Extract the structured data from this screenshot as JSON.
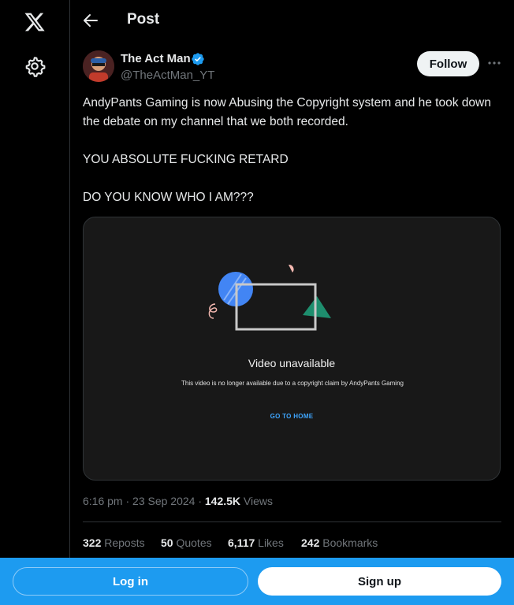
{
  "nav": {
    "logo_icon": "x-logo-icon",
    "settings_icon": "gear-icon"
  },
  "header": {
    "title": "Post",
    "back_icon": "arrow-left-icon"
  },
  "post": {
    "author_name": "The Act Man",
    "author_handle": "@TheActMan_YT",
    "verified": true,
    "follow_label": "Follow",
    "more_icon": "more-horizontal-icon",
    "text_lines": [
      "AndyPants Gaming is now Abusing the Copyright system and he took down the debate on my channel that we both recorded.",
      "YOU ABSOLUTE FUCKING RETARD",
      "DO YOU KNOW WHO I AM???"
    ],
    "media": {
      "title": "Video unavailable",
      "description": "This video is no longer available due to a copyright claim by AndyPants Gaming",
      "link_label": "GO TO HOME"
    },
    "timestamp": "6:16 pm · 23 Sep 2024 · ",
    "views_count": "142.5K",
    "views_label": "Views",
    "stats": {
      "reposts_count": "322",
      "reposts_label": "Reposts",
      "quotes_count": "50",
      "quotes_label": "Quotes",
      "likes_count": "6,117",
      "likes_label": "Likes",
      "bookmarks_count": "242",
      "bookmarks_label": "Bookmarks"
    }
  },
  "bottom_bar": {
    "login_label": "Log in",
    "signup_label": "Sign up"
  },
  "colors": {
    "background": "#000000",
    "accent": "#1d9bf0",
    "text_primary": "#e7e9ea",
    "text_secondary": "#71767b"
  }
}
